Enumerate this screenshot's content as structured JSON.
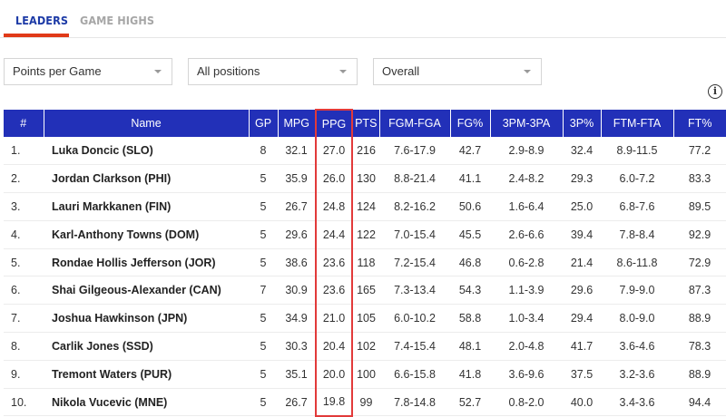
{
  "tabs": [
    {
      "label": "LEADERS",
      "active": true
    },
    {
      "label": "GAME HIGHS",
      "active": false
    }
  ],
  "filters": {
    "stat": "Points per Game",
    "position": "All positions",
    "scope": "Overall"
  },
  "info_icon": "info-icon",
  "colors": {
    "header_bg": "#2230b8",
    "accent_red": "#e03a18",
    "highlight_border": "#e23a3a",
    "tab_active": "#1c3aa6"
  },
  "table": {
    "columns": [
      "#",
      "Name",
      "GP",
      "MPG",
      "PPG",
      "PTS",
      "FGM-FGA",
      "FG%",
      "3PM-3PA",
      "3P%",
      "FTM-FTA",
      "FT%"
    ],
    "highlighted_column": "PPG",
    "rows": [
      {
        "rank": "1.",
        "name": "Luka Doncic (SLO)",
        "gp": "8",
        "mpg": "32.1",
        "ppg": "27.0",
        "pts": "216",
        "fgm_fga": "7.6-17.9",
        "fg_pct": "42.7",
        "tpm_tpa": "2.9-8.9",
        "tp_pct": "32.4",
        "ftm_fta": "8.9-11.5",
        "ft_pct": "77.2"
      },
      {
        "rank": "2.",
        "name": "Jordan Clarkson (PHI)",
        "gp": "5",
        "mpg": "35.9",
        "ppg": "26.0",
        "pts": "130",
        "fgm_fga": "8.8-21.4",
        "fg_pct": "41.1",
        "tpm_tpa": "2.4-8.2",
        "tp_pct": "29.3",
        "ftm_fta": "6.0-7.2",
        "ft_pct": "83.3"
      },
      {
        "rank": "3.",
        "name": "Lauri Markkanen (FIN)",
        "gp": "5",
        "mpg": "26.7",
        "ppg": "24.8",
        "pts": "124",
        "fgm_fga": "8.2-16.2",
        "fg_pct": "50.6",
        "tpm_tpa": "1.6-6.4",
        "tp_pct": "25.0",
        "ftm_fta": "6.8-7.6",
        "ft_pct": "89.5"
      },
      {
        "rank": "4.",
        "name": "Karl-Anthony Towns (DOM)",
        "gp": "5",
        "mpg": "29.6",
        "ppg": "24.4",
        "pts": "122",
        "fgm_fga": "7.0-15.4",
        "fg_pct": "45.5",
        "tpm_tpa": "2.6-6.6",
        "tp_pct": "39.4",
        "ftm_fta": "7.8-8.4",
        "ft_pct": "92.9"
      },
      {
        "rank": "5.",
        "name": "Rondae Hollis Jefferson (JOR)",
        "gp": "5",
        "mpg": "38.6",
        "ppg": "23.6",
        "pts": "118",
        "fgm_fga": "7.2-15.4",
        "fg_pct": "46.8",
        "tpm_tpa": "0.6-2.8",
        "tp_pct": "21.4",
        "ftm_fta": "8.6-11.8",
        "ft_pct": "72.9"
      },
      {
        "rank": "6.",
        "name": "Shai Gilgeous-Alexander (CAN)",
        "gp": "7",
        "mpg": "30.9",
        "ppg": "23.6",
        "pts": "165",
        "fgm_fga": "7.3-13.4",
        "fg_pct": "54.3",
        "tpm_tpa": "1.1-3.9",
        "tp_pct": "29.6",
        "ftm_fta": "7.9-9.0",
        "ft_pct": "87.3"
      },
      {
        "rank": "7.",
        "name": "Joshua Hawkinson (JPN)",
        "gp": "5",
        "mpg": "34.9",
        "ppg": "21.0",
        "pts": "105",
        "fgm_fga": "6.0-10.2",
        "fg_pct": "58.8",
        "tpm_tpa": "1.0-3.4",
        "tp_pct": "29.4",
        "ftm_fta": "8.0-9.0",
        "ft_pct": "88.9"
      },
      {
        "rank": "8.",
        "name": "Carlik Jones (SSD)",
        "gp": "5",
        "mpg": "30.3",
        "ppg": "20.4",
        "pts": "102",
        "fgm_fga": "7.4-15.4",
        "fg_pct": "48.1",
        "tpm_tpa": "2.0-4.8",
        "tp_pct": "41.7",
        "ftm_fta": "3.6-4.6",
        "ft_pct": "78.3"
      },
      {
        "rank": "9.",
        "name": "Tremont Waters (PUR)",
        "gp": "5",
        "mpg": "35.1",
        "ppg": "20.0",
        "pts": "100",
        "fgm_fga": "6.6-15.8",
        "fg_pct": "41.8",
        "tpm_tpa": "3.6-9.6",
        "tp_pct": "37.5",
        "ftm_fta": "3.2-3.6",
        "ft_pct": "88.9"
      },
      {
        "rank": "10.",
        "name": "Nikola Vucevic (MNE)",
        "gp": "5",
        "mpg": "26.7",
        "ppg": "19.8",
        "pts": "99",
        "fgm_fga": "7.8-14.8",
        "fg_pct": "52.7",
        "tpm_tpa": "0.8-2.0",
        "tp_pct": "40.0",
        "ftm_fta": "3.4-3.6",
        "ft_pct": "94.4"
      }
    ]
  }
}
